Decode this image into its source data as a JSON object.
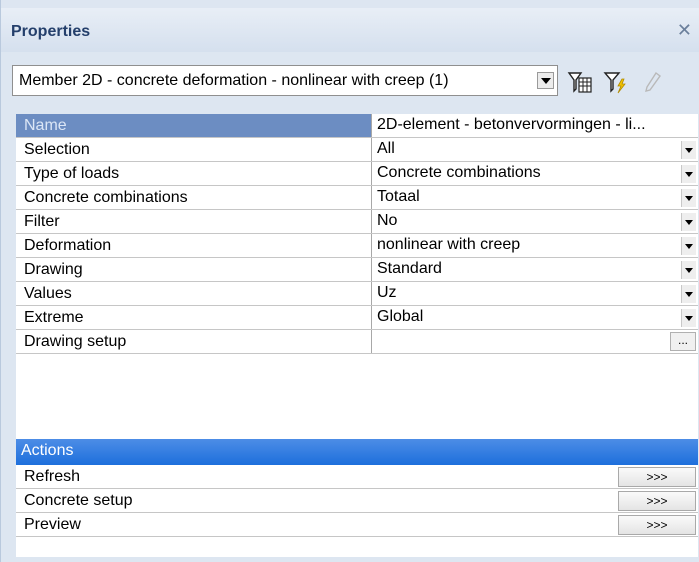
{
  "panel": {
    "title": "Properties"
  },
  "selector": {
    "value": "Member 2D - concrete deformation - nonlinear with creep (1)"
  },
  "toolbar": {
    "icons": [
      "filter-table-icon",
      "filter-lightning-icon",
      "pencil-icon"
    ]
  },
  "properties": {
    "header": {
      "label": "Name",
      "value": "2D-element - betonvervormingen - li..."
    },
    "rows": [
      {
        "label": "Selection",
        "value": "All"
      },
      {
        "label": "Type of loads",
        "value": "Concrete combinations"
      },
      {
        "label": "Concrete combinations",
        "value": "Totaal"
      },
      {
        "label": "Filter",
        "value": "No"
      },
      {
        "label": "Deformation",
        "value": "nonlinear with creep"
      },
      {
        "label": "Drawing",
        "value": "Standard"
      },
      {
        "label": "Values",
        "value": "Uz"
      },
      {
        "label": "Extreme",
        "value": "Global"
      },
      {
        "label": "Drawing setup",
        "value": "",
        "button": "..."
      }
    ]
  },
  "actions": {
    "title": "Actions",
    "items": [
      {
        "label": "Refresh",
        "button": ">>>"
      },
      {
        "label": "Concrete setup",
        "button": ">>>"
      },
      {
        "label": "Preview",
        "button": ">>>"
      }
    ]
  },
  "colors": {
    "title_text": "#243f6b",
    "name_header_bg": "#6c8dc2",
    "actions_header_bg": "#2b78e0"
  }
}
